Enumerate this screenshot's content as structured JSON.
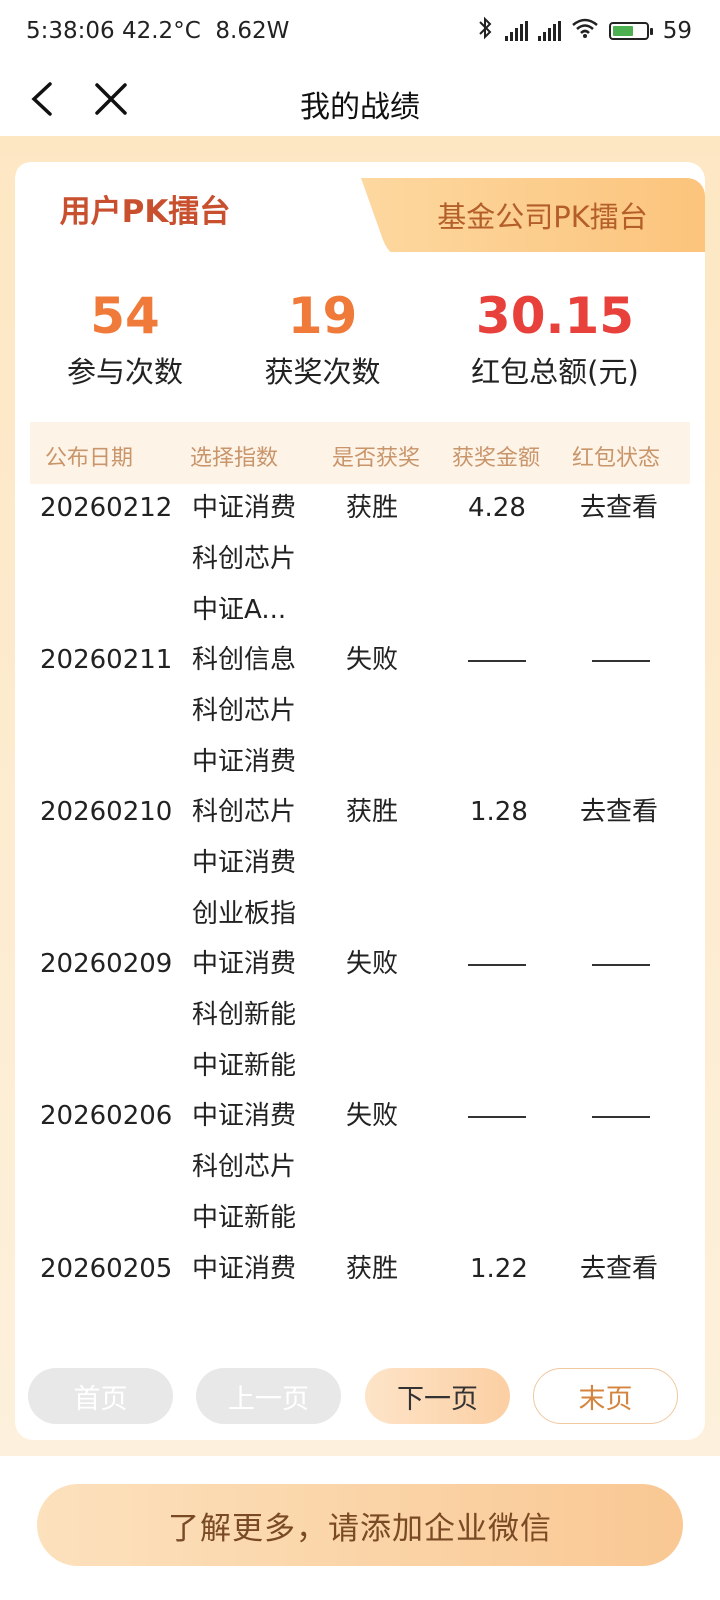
{
  "status_bar": {
    "time": "5:38:06",
    "temperature": "42.2°C",
    "power": "8.62W",
    "battery": "59"
  },
  "nav": {
    "title": "我的战绩"
  },
  "tabs": {
    "active": "用户PK擂台",
    "inactive": "基金公司PK擂台"
  },
  "stats": {
    "participations": {
      "value": "54",
      "label": "参与次数",
      "color": "#f07a3a"
    },
    "wins": {
      "value": "19",
      "label": "获奖次数",
      "color": "#f07a3a"
    },
    "total": {
      "value": "30.15",
      "label": "红包总额(元)",
      "color": "#e8403a"
    }
  },
  "table": {
    "headers": [
      "公布日期",
      "选择指数",
      "是否获奖",
      "获奖金额",
      "红包状态"
    ],
    "rows": [
      {
        "date": "20260212",
        "indices": [
          "中证消费",
          "科创芯片",
          "中证A..."
        ],
        "result": "获胜",
        "amount": "4.28",
        "status": "去查看"
      },
      {
        "date": "20260211",
        "indices": [
          "科创信息",
          "科创芯片",
          "中证消费"
        ],
        "result": "失败",
        "amount": "",
        "status": ""
      },
      {
        "date": "20260210",
        "indices": [
          "科创芯片",
          "中证消费",
          "创业板指"
        ],
        "result": "获胜",
        "amount": "1.28",
        "status": "去查看"
      },
      {
        "date": "20260209",
        "indices": [
          "中证消费",
          "科创新能",
          "中证新能"
        ],
        "result": "失败",
        "amount": "",
        "status": ""
      },
      {
        "date": "20260206",
        "indices": [
          "中证消费",
          "科创芯片",
          "中证新能"
        ],
        "result": "失败",
        "amount": "",
        "status": ""
      },
      {
        "date": "20260205",
        "indices": [
          "中证消费"
        ],
        "result": "获胜",
        "amount": "1.22",
        "status": "去查看"
      }
    ]
  },
  "pager": {
    "first": "首页",
    "prev": "上一页",
    "next": "下一页",
    "last": "末页"
  },
  "cta": {
    "label": "了解更多，请添加企业微信"
  },
  "colors": {
    "accent": "#f07a3a",
    "red": "#e8403a",
    "tab_text": "#c8502e"
  }
}
